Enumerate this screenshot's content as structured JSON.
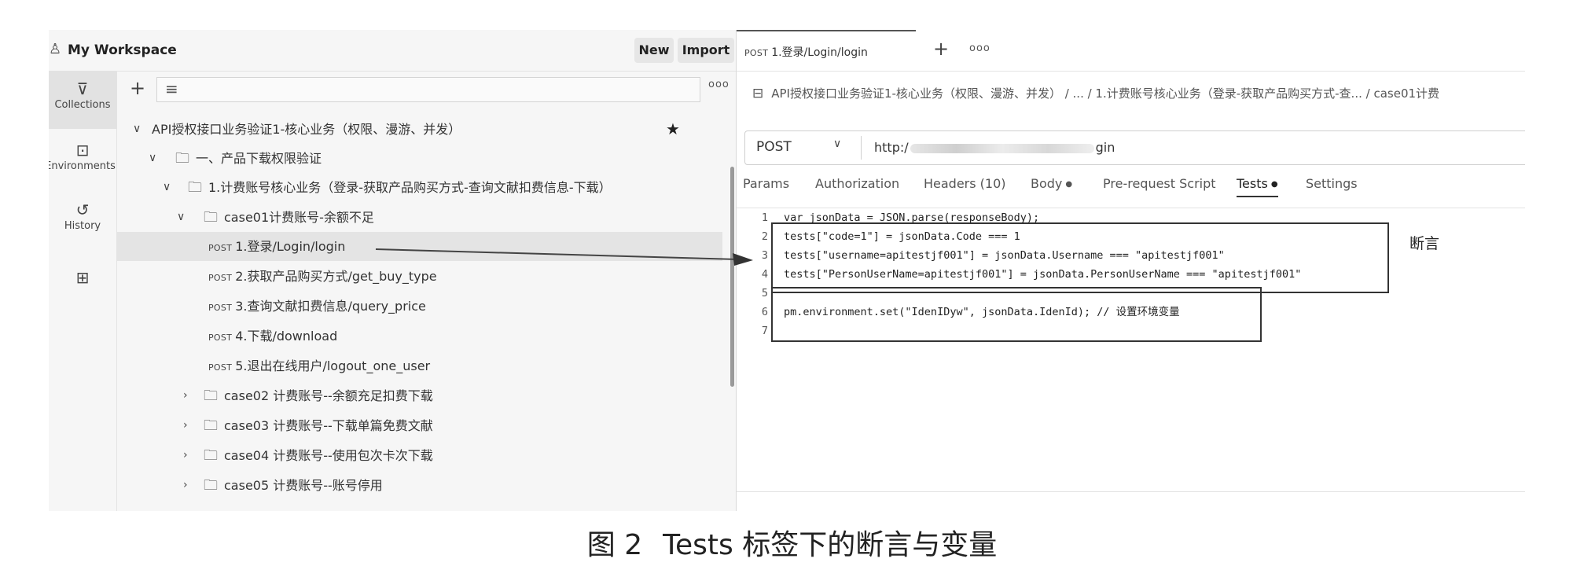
{
  "workspace": {
    "title": "My Workspace",
    "new_label": "New",
    "import_label": "Import"
  },
  "rail": [
    {
      "label": "Collections",
      "icon": "collections-icon"
    },
    {
      "label": "Environments",
      "icon": "environments-icon"
    },
    {
      "label": "History",
      "icon": "history-icon"
    },
    {
      "label": "",
      "icon": "add-app-icon"
    }
  ],
  "tree": {
    "collection": "API授权接口业务验证1-核心业务（权限、漫游、并发）",
    "folder1": "一、产品下载权限验证",
    "folder2": "1.计费账号核心业务（登录-获取产品购买方式-查询文献扣费信息-下载）",
    "case01": "case01计费账号-余额不足",
    "method": "POST",
    "requests": [
      "1.登录/Login/login",
      "2.获取产品购买方式/get_buy_type",
      "3.查询文献扣费信息/query_price",
      "4.下载/download",
      "5.退出在线用户/logout_one_user"
    ],
    "cases": [
      "case02 计费账号--余额充足扣费下载",
      "case03 计费账号--下载单篇免费文献",
      "case04 计费账号--使用包次卡次下载",
      "case05 计费账号--账号停用"
    ]
  },
  "request": {
    "tab_method": "POST",
    "tab_title": "1.登录/Login/login",
    "breadcrumb": "API授权接口业务验证1-核心业务（权限、漫游、并发） / ... / 1.计费账号核心业务（登录-获取产品购买方式-查... / case01计费",
    "method": "POST",
    "url_start": "http:/",
    "url_end": "gin",
    "tabs": [
      "Params",
      "Authorization",
      "Headers (10)",
      "Body",
      "Pre-request Script",
      "Tests",
      "Settings"
    ],
    "active_tab": "Tests"
  },
  "code": [
    {
      "n": "1",
      "text": "var jsonData = JSON.parse(responseBody);"
    },
    {
      "n": "2",
      "text": "tests[\"code=1\"] = jsonData.Code === 1"
    },
    {
      "n": "3",
      "text": "tests[\"username=apitestjf001\"] = jsonData.Username === \"apitestjf001\""
    },
    {
      "n": "4",
      "text": "tests[\"PersonUserName=apitestjf001\"] = jsonData.PersonUserName === \"apitestjf001\""
    },
    {
      "n": "5",
      "text": ""
    },
    {
      "n": "6",
      "text": "pm.environment.set(\"IdenIDyw\", jsonData.IdenId); // 设置环境变量"
    },
    {
      "n": "7",
      "text": ""
    }
  ],
  "annotation": "断言",
  "caption": {
    "number": "图 2",
    "text": "Tests 标签下的断言与变量"
  }
}
